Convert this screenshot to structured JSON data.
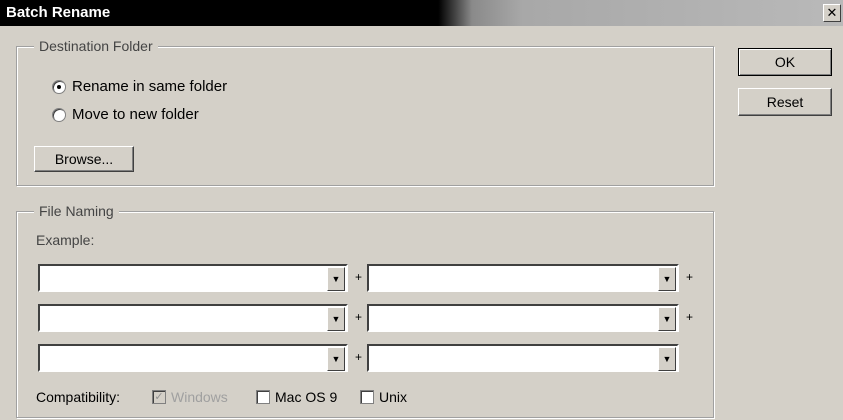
{
  "window": {
    "title": "Batch Rename",
    "close_glyph": "✕"
  },
  "destination": {
    "legend": "Destination Folder",
    "options": [
      {
        "label": "Rename in same folder",
        "checked": true
      },
      {
        "label": "Move to new folder",
        "checked": false
      }
    ],
    "browse_label": "Browse..."
  },
  "buttons": {
    "ok": "OK",
    "reset": "Reset"
  },
  "file_naming": {
    "legend": "File Naming",
    "example_label": "Example:",
    "plus": "+",
    "rows": [
      {
        "left": "",
        "right": ""
      },
      {
        "left": "",
        "right": ""
      },
      {
        "left": "",
        "right": ""
      }
    ]
  },
  "compatibility": {
    "label": "Compatibility:",
    "options": [
      {
        "label": "Windows",
        "checked": true,
        "disabled": true
      },
      {
        "label": "Mac OS 9",
        "checked": false,
        "disabled": false
      },
      {
        "label": "Unix",
        "checked": false,
        "disabled": false
      }
    ]
  },
  "icons": {
    "close": "close-icon",
    "dropdown": "chevron-down-icon",
    "check": "check-icon"
  },
  "colors": {
    "face": "#d4d0c8",
    "titlebar": "#000000"
  }
}
